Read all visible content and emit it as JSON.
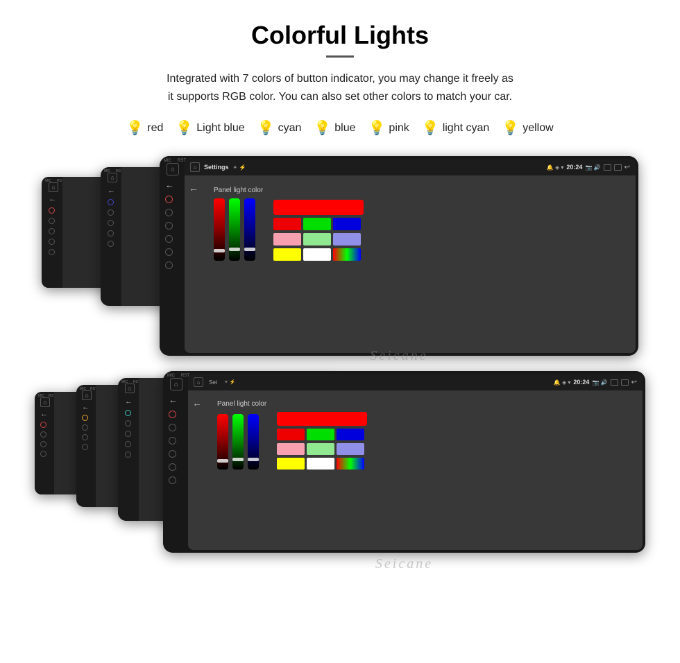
{
  "title": "Colorful Lights",
  "description": "Integrated with 7 colors of button indicator, you may change it freely as\nit supports RGB color. You can also set other colors to match your car.",
  "colors": [
    {
      "name": "red",
      "emoji": "🔴",
      "color": "#ff4444"
    },
    {
      "name": "Light blue",
      "emoji": "💙",
      "color": "#88ccff"
    },
    {
      "name": "cyan",
      "emoji": "💠",
      "color": "#00dddd"
    },
    {
      "name": "blue",
      "emoji": "🔵",
      "color": "#4488ff"
    },
    {
      "name": "pink",
      "emoji": "🩷",
      "color": "#ff66aa"
    },
    {
      "name": "light cyan",
      "emoji": "🩵",
      "color": "#aaeeff"
    },
    {
      "name": "yellow",
      "emoji": "💛",
      "color": "#ffee44"
    }
  ],
  "screen": {
    "title": "Settings",
    "time": "20:24",
    "panel_label": "Panel light color",
    "watermark": "Seicane"
  },
  "toolbar": {}
}
